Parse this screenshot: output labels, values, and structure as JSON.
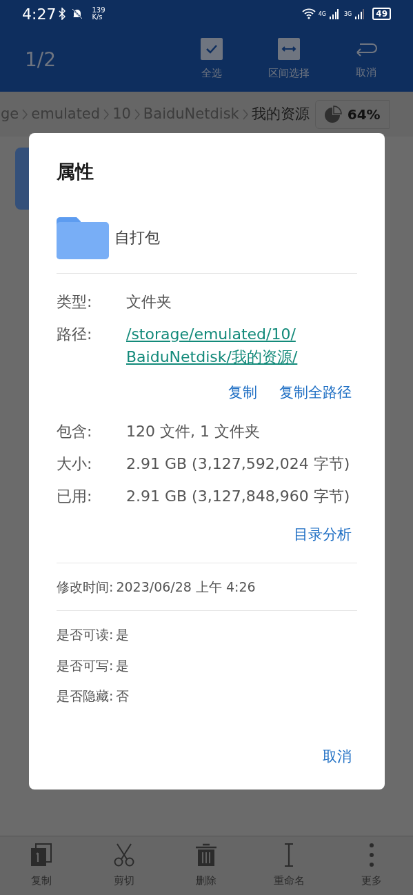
{
  "status_bar": {
    "time": "4:27",
    "speed_value": "139",
    "speed_unit": "K/s",
    "network_1": "4G",
    "network_2": "3G",
    "battery": "49"
  },
  "app_bar": {
    "counter": "1/2",
    "actions": [
      {
        "label": "全选"
      },
      {
        "label": "区间选择"
      },
      {
        "label": "取消"
      }
    ]
  },
  "breadcrumb": {
    "items": [
      "ge",
      "emulated",
      "10",
      "BaiduNetdisk",
      "我的资源"
    ],
    "storage": "64%"
  },
  "dialog": {
    "title": "属性",
    "name": "自打包",
    "info": [
      {
        "label": "类型:",
        "value": "文件夹",
        "kind": "text"
      },
      {
        "label": "路径:",
        "value": "/storage/emulated/10/\nBaiduNetdisk/我的资源/",
        "kind": "link"
      }
    ],
    "path_actions": [
      "复制",
      "复制全路径"
    ],
    "sizes": [
      {
        "label": "包含:",
        "value": "120 文件, 1 文件夹"
      },
      {
        "label": "大小:",
        "value": "2.91 GB (3,127,592,024 字节)"
      },
      {
        "label": "已用:",
        "value": "2.91 GB (3,127,848,960 字节)"
      }
    ],
    "analyze": "目录分析",
    "modified": {
      "label": "修改时间:",
      "value": "2023/06/28 上午 4:26"
    },
    "permissions": [
      {
        "label": "是否可读:",
        "value": "是"
      },
      {
        "label": "是否可写:",
        "value": "是"
      },
      {
        "label": "是否隐藏:",
        "value": "否"
      }
    ],
    "cancel": "取消"
  },
  "bottom_bar": [
    {
      "label": "复制"
    },
    {
      "label": "剪切"
    },
    {
      "label": "删除"
    },
    {
      "label": "重命名"
    },
    {
      "label": "更多"
    }
  ]
}
